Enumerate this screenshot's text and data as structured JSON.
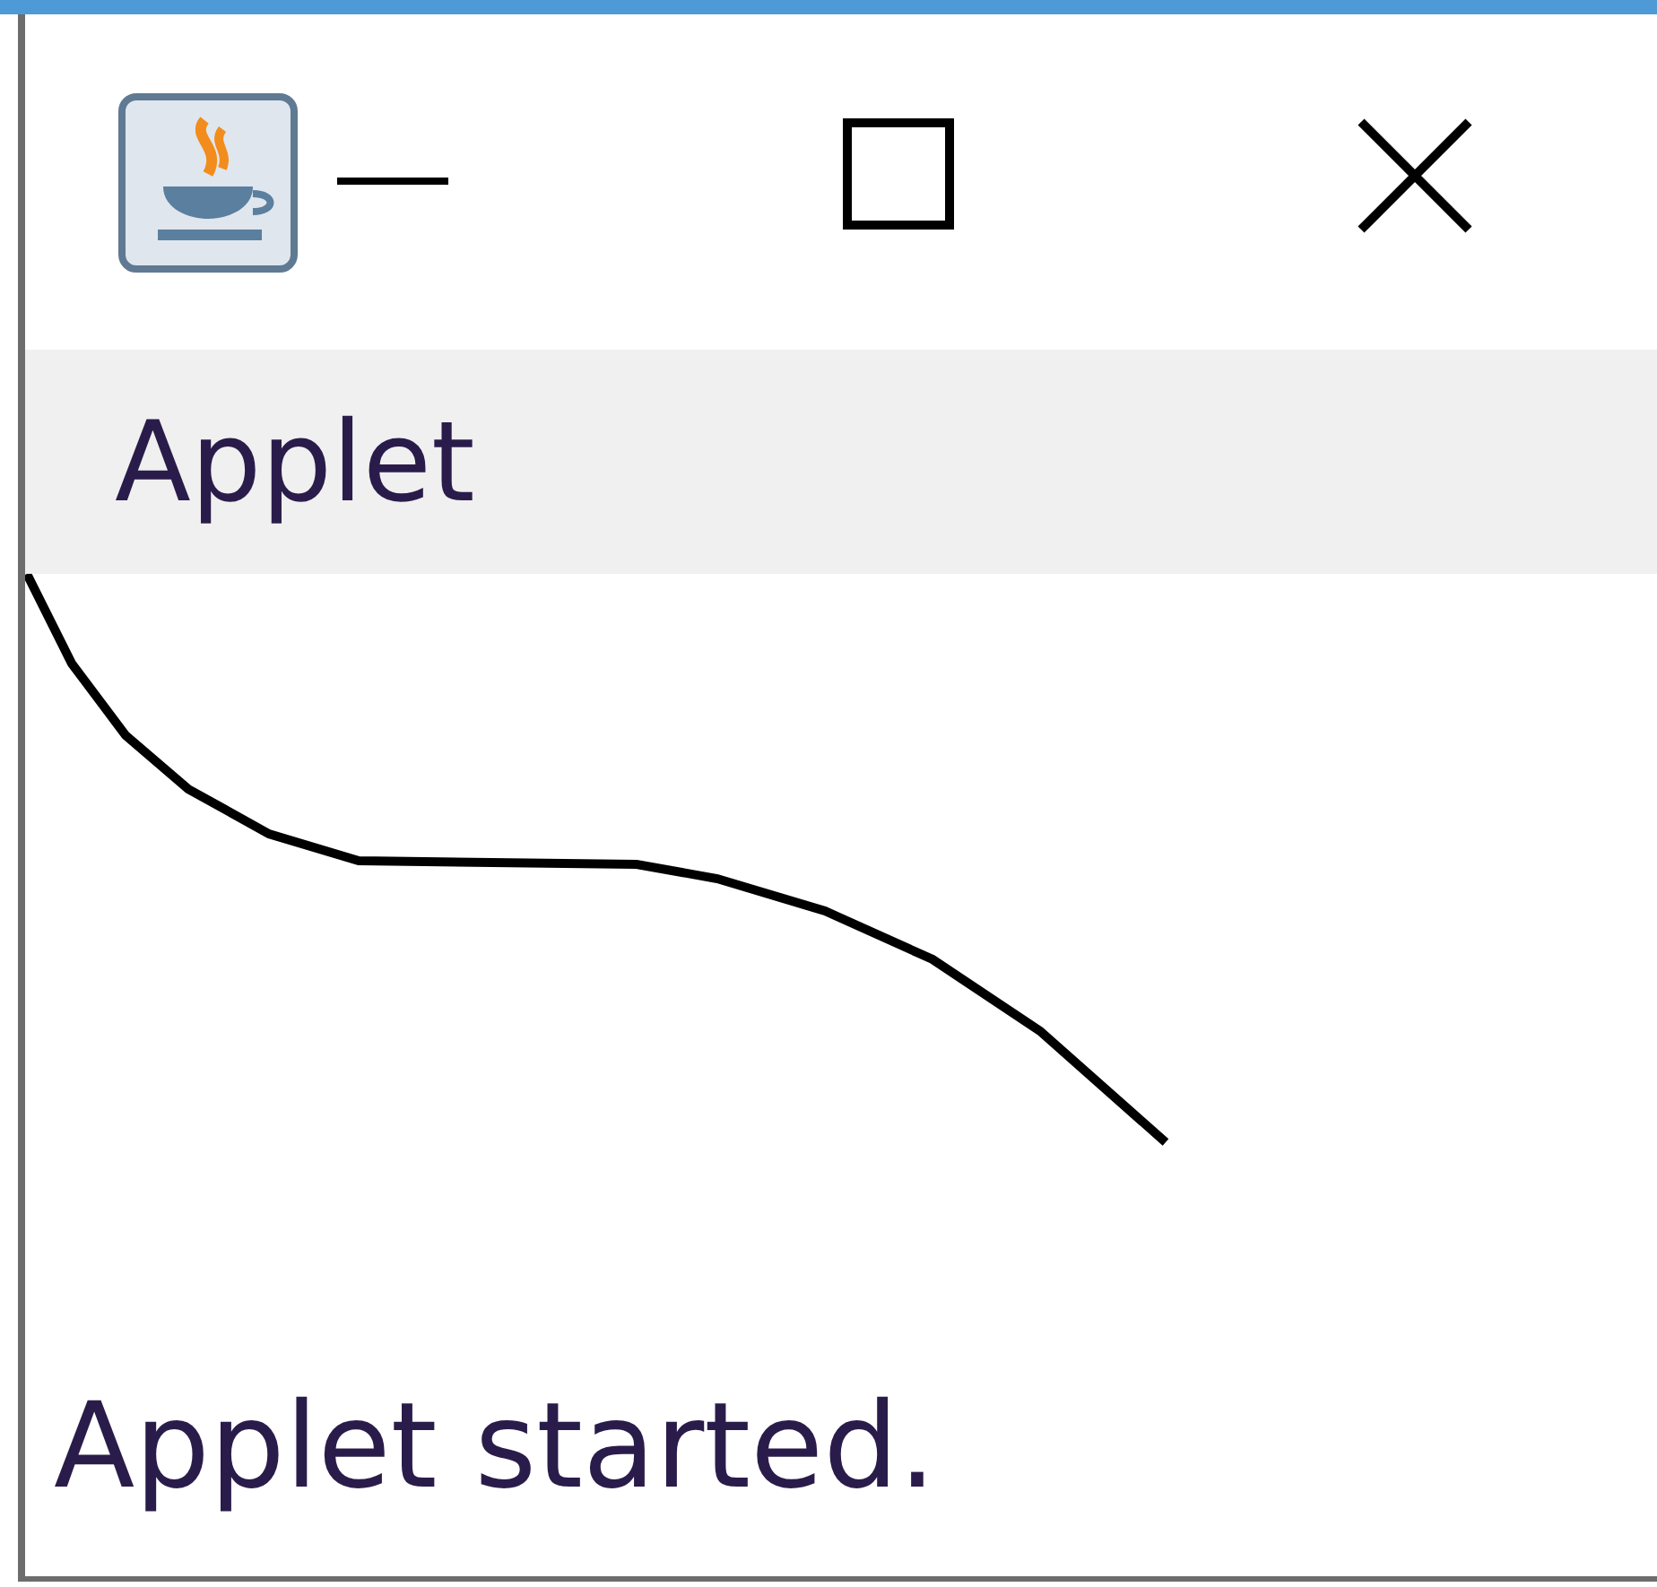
{
  "menu_bar": {
    "items": [
      {
        "label": "Applet"
      }
    ]
  },
  "status_bar": {
    "text": "Applet started."
  }
}
